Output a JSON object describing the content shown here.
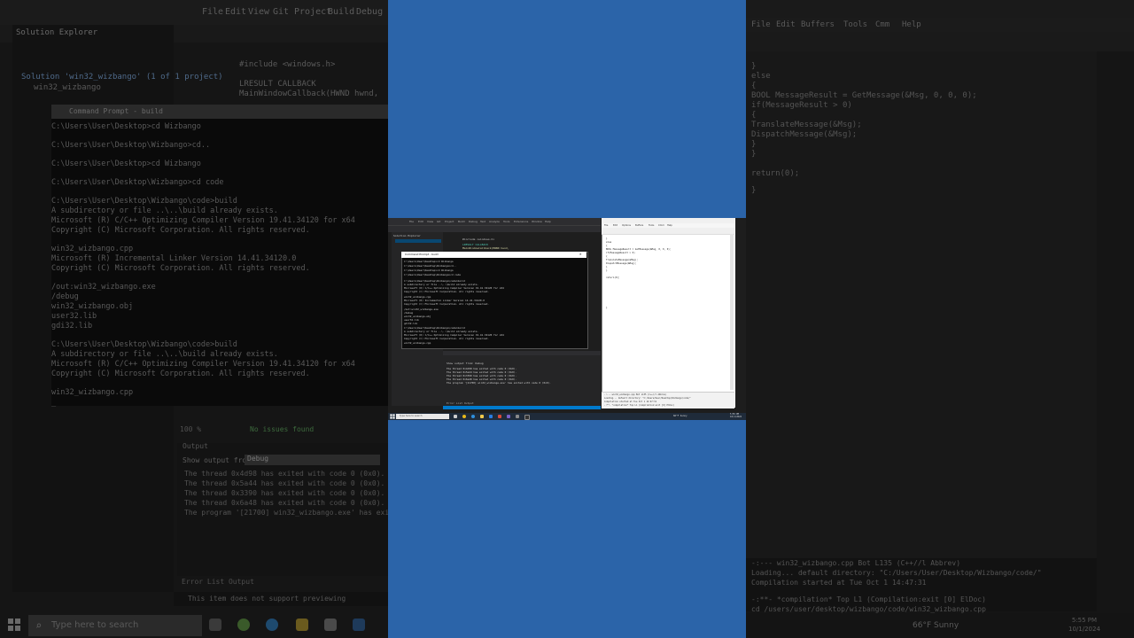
{
  "background_left": {
    "menu": [
      "File",
      "Edit",
      "View",
      "Git",
      "Project",
      "Build",
      "Debug"
    ],
    "solution_explorer_title": "Solution Explorer",
    "solution_item": "Solution 'win32_wizbango' (1 of 1 project)",
    "project_item": "win32_wizbango",
    "editor_lines": [
      "#include <windows.h>",
      "LRESULT CALLBACK",
      "MainWindowCallback(HWND hwnd,"
    ],
    "cmd_title": "Command Prompt - build",
    "cmd_lines": [
      "C:\\Users\\User\\Desktop>cd Wizbango",
      "C:\\Users\\User\\Desktop\\Wizbango>cd..",
      "C:\\Users\\User\\Desktop>cd Wizbango",
      "C:\\Users\\User\\Desktop\\Wizbango>cd code",
      "C:\\Users\\User\\Desktop\\Wizbango\\code>build",
      "A subdirectory or file ..\\..\\build already exists.",
      "Microsoft (R) C/C++ Optimizing Compiler Version 19.41.34120 for x64",
      "Copyright (C) Microsoft Corporation.  All rights reserved.",
      "win32_wizbango.cpp",
      "Microsoft (R) Incremental Linker Version 14.41.34120.0",
      "Copyright (C) Microsoft Corporation.  All rights reserved.",
      "/out:win32_wizbango.exe",
      "/debug",
      "win32_wizbango.obj",
      "user32.lib",
      "gdi32.lib",
      "C:\\Users\\User\\Desktop\\Wizbango\\code>build",
      "A subdirectory or file ..\\..\\build already exists.",
      "Microsoft (R) C/C++ Optimizing Compiler Version 19.41.34120 for x64",
      "Copyright (C) Microsoft Corporation.  All rights reserved.",
      "win32_wizbango.cpp",
      "_"
    ],
    "zoom": "100 %",
    "issues": "No issues found",
    "output_title": "Output",
    "show_output_from": "Show output from:",
    "output_source": "Debug",
    "output_lines": [
      "The thread 0x4d98 has exited with code 0 (0x0).",
      "The thread 0x5a44 has exited with code 0 (0x0).",
      "The thread 0x3390 has exited with code 0 (0x0).",
      "The thread 0x6a48 has exited with code 0 (0x0).",
      "The program '[21700] win32_wizbango.exe' has exited with code 0 (0x0)."
    ],
    "output_tabs": "Error List   Output",
    "status": "This item does not support previewing",
    "search_placeholder": "Type here to search"
  },
  "background_right": {
    "menu": [
      "File",
      "Edit",
      "Buffers",
      "Tools",
      "Cmm",
      "Help"
    ],
    "editor_lines": [
      "    }",
      "    else",
      "    {",
      "        BOOL MessageResult = GetMessage(&Msg, 0, 0, 0);",
      "        if(MessageResult > 0)",
      "        {",
      "            TranslateMessage(&Msg);",
      "            DispatchMessage(&Msg);",
      "        }",
      "    }",
      "",
      "    return(0);",
      "}"
    ],
    "status_lines": [
      "-:---  win32_wizbango.cpp   Bot   L135   (C++//l Abbrev)",
      "Loading... default directory: \"C:/Users/User/Desktop/Wizbango/code/\"",
      "Compilation started at Tue Oct  1 14:47:31",
      "-:**-  *compilation*   Top   L1   (Compilation:exit [0] ElDoc)",
      "cd /users/user/desktop/wizbango/code/win32_wizbango.cpp"
    ],
    "weather": "66°F Sunny",
    "clock_time": "5:55 PM",
    "clock_date": "10/1/2024"
  },
  "desktop": {
    "vs_menu": [
      "File",
      "Edit",
      "View",
      "Git",
      "Project",
      "Build",
      "Debug",
      "Test",
      "Analyze",
      "Tools",
      "Extensions",
      "Window",
      "Help"
    ],
    "vs_solution_title": "Solution Explorer",
    "vs_code_lines": [
      "#include <windows.h>",
      "LRESULT CALLBACK",
      "MainWindowCallback(HWND hwnd,"
    ],
    "cmd_title": "Command Prompt - build",
    "cmd_lines": [
      "C:\\Users\\User\\Desktop>cd Wizbango",
      "C:\\Users\\User\\Desktop\\Wizbango>cd..",
      "C:\\Users\\User\\Desktop>cd Wizbango",
      "C:\\Users\\User\\Desktop\\Wizbango>cd code",
      "C:\\Users\\User\\Desktop\\Wizbango\\code>build",
      "A subdirectory or file ..\\..\\build already exists.",
      "Microsoft (R) C/C++ Optimizing Compiler Version 19.41.34120 for x64",
      "Copyright (C) Microsoft Corporation.  All rights reserved.",
      "win32_wizbango.cpp",
      "Microsoft (R) Incremental Linker Version 14.41.34120.0",
      "Copyright (C) Microsoft Corporation.  All rights reserved.",
      "/out:win32_wizbango.exe",
      "/debug",
      "win32_wizbango.obj",
      "user32.lib",
      "gdi32.lib",
      "C:\\Users\\User\\Desktop\\Wizbango\\code>build",
      "A subdirectory or file ..\\..\\build already exists.",
      "Microsoft (R) C/C++ Optimizing Compiler Version 19.41.34120 for x64",
      "Copyright (C) Microsoft Corporation.  All rights reserved.",
      "win32_wizbango.cpp"
    ],
    "output_show": "Show output from:  Debug",
    "output_lines": [
      "The thread 0x4d98 has exited with code 0 (0x0).",
      "The thread 0x5a44 has exited with code 0 (0x0).",
      "The thread 0x3390 has exited with code 0 (0x0).",
      "The thread 0x6a48 has exited with code 0 (0x0).",
      "The program '[21700] win32_wizbango.exe' has exited with code 0 (0x0)."
    ],
    "output_tabs": "Error List   Output",
    "np_menu": [
      "File",
      "Edit",
      "Options",
      "Buffers",
      "Tools",
      "Cmm",
      "Help"
    ],
    "np_lines": [
      "    }",
      "    else",
      "    {",
      "        BOOL MessageResult = GetMessage(&Msg, 0, 0, 0);",
      "        if(MessageResult > 0)",
      "        {",
      "            TranslateMessage(&Msg);",
      "            DispatchMessage(&Msg);",
      "        }",
      "    }",
      "",
      "    return(0);",
      "}"
    ],
    "np_status": [
      "-:---  win32_wizbango.cpp   Bot   L135   (C++//l Abbrev)",
      "Loading... default directory: \"C:/Users/User/Desktop/Wizbango/code/\"",
      "Compilation started at Tue Oct  1 14:47:31",
      "-:**-  *compilation*   Top   L1   (Compilation:exit [0] ElDoc)"
    ],
    "search_placeholder": "Type here to search",
    "weather": "66°F Sunny",
    "clock_time": "5:55 PM",
    "clock_date": "10/1/2024"
  },
  "colors": {
    "center_blue": "#2b64a9",
    "vs_dark": "#1e1e1e",
    "vs_accent": "#007acc",
    "selection": "#094771"
  }
}
